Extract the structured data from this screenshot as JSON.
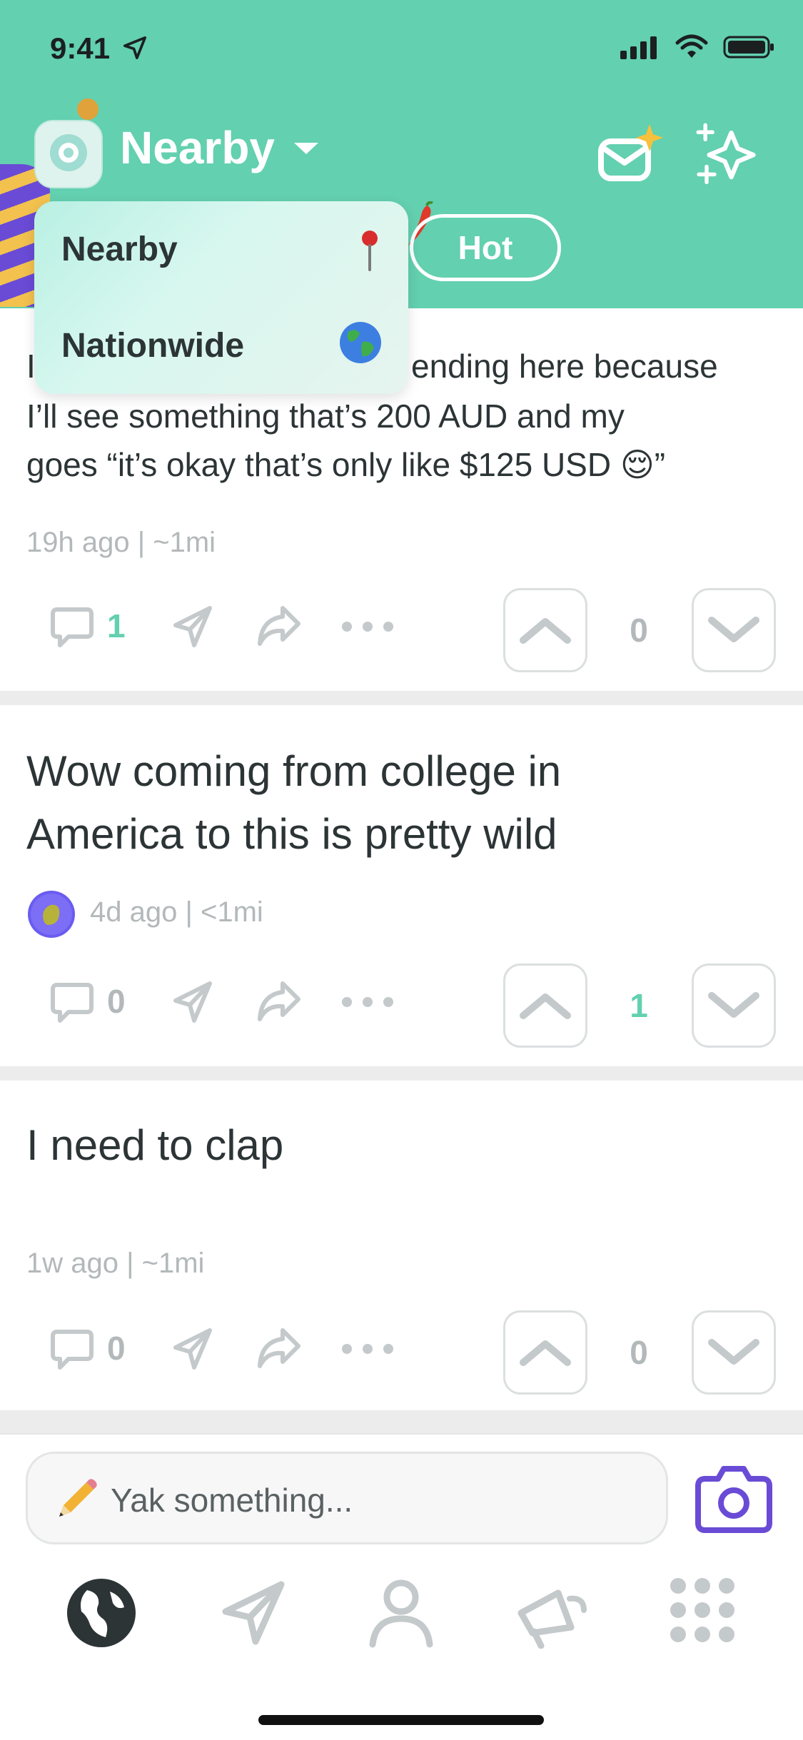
{
  "status_bar": {
    "time": "9:41"
  },
  "header": {
    "feed_title": "Nearby",
    "tabs": [
      {
        "label": "Hot"
      }
    ]
  },
  "dropdown": {
    "items": [
      {
        "label": "Nearby",
        "icon": "pin-icon"
      },
      {
        "label": "Nationwide",
        "icon": "globe-icon"
      }
    ]
  },
  "posts": [
    {
      "text_visible": [
        "I",
        "ending here because",
        "I’ll see something that’s 200 AUD and my",
        "goes “it’s okay that’s only like $125 USD 😌”"
      ],
      "meta": "19h ago | ~1mi",
      "comments": "1",
      "score": "0"
    },
    {
      "text_lines": [
        "Wow coming from college in",
        "America to this is pretty wild"
      ],
      "meta": "4d ago | <1mi",
      "comments": "0",
      "score": "1"
    },
    {
      "text_lines": [
        "I need to clap"
      ],
      "meta": "1w ago | ~1mi",
      "comments": "0",
      "score": "0"
    }
  ],
  "composer": {
    "placeholder": "Yak something..."
  },
  "colors": {
    "brand": "#63d0b0",
    "accent_purple": "#6a4bd6",
    "muted": "#b3b8ba"
  }
}
